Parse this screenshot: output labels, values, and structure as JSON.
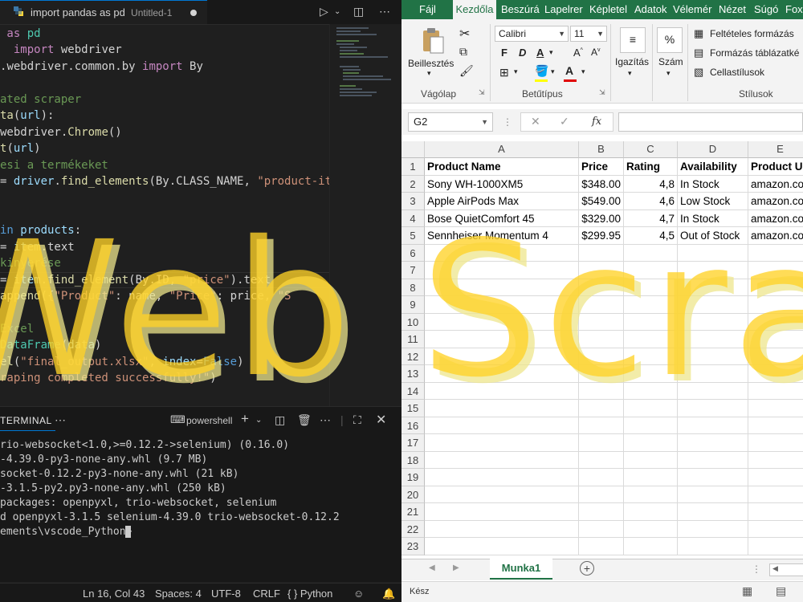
{
  "vscode": {
    "tab": {
      "title": "import pandas as pd",
      "subtitle": "Untitled-1"
    },
    "code_lines": [
      [
        [
          "kw",
          " as "
        ],
        [
          "cls",
          "pd"
        ]
      ],
      [
        [
          "wh",
          "  "
        ],
        [
          "kw",
          "import"
        ],
        [
          "wh",
          " webdriver"
        ]
      ],
      [
        [
          "wh",
          "."
        ],
        [
          "wh",
          "webdriver.common.by "
        ],
        [
          "kw",
          "import"
        ],
        [
          "wh",
          " By"
        ]
      ],
      [],
      [
        [
          "cmt",
          "ated scraper"
        ]
      ],
      [
        [
          "fn",
          "ta"
        ],
        [
          "wh",
          "("
        ],
        [
          "var",
          "url"
        ],
        [
          "wh",
          "):"
        ]
      ],
      [
        [
          "wh",
          "webdriver."
        ],
        [
          "fn",
          "Chrome"
        ],
        [
          "wh",
          "()"
        ]
      ],
      [
        [
          "fn",
          "t"
        ],
        [
          "wh",
          "("
        ],
        [
          "var",
          "url"
        ],
        [
          "wh",
          ")"
        ]
      ],
      [
        [
          "cmt",
          "esi a termékeket"
        ]
      ],
      [
        [
          "wh",
          "= "
        ],
        [
          "var",
          "driver"
        ],
        [
          "wh",
          "."
        ],
        [
          "fn",
          "find_elements"
        ],
        [
          "wh",
          "(By.CLASS_NAME, "
        ],
        [
          "str",
          "\"product-ite"
        ]
      ],
      [],
      [],
      [
        [
          "bi",
          "in"
        ],
        [
          "wh",
          " "
        ],
        [
          "var",
          "products"
        ],
        [
          "wh",
          ":"
        ]
      ],
      [
        [
          "wh",
          "= "
        ],
        [
          "var",
          "item"
        ],
        [
          "wh",
          ".text"
        ]
      ],
      [
        [
          "cmt",
          "kinyerése"
        ]
      ],
      [
        [
          "wh",
          "= "
        ],
        [
          "var",
          "item"
        ],
        [
          "wh",
          "."
        ],
        [
          "fn",
          "find_element"
        ],
        [
          "wh",
          "(By.ID, "
        ],
        [
          "str",
          "\"price\""
        ],
        [
          "wh",
          ").text"
        ]
      ],
      [
        [
          "fn",
          "append"
        ],
        [
          "wh",
          "({"
        ],
        [
          "str",
          "\"Product\""
        ],
        [
          "wh",
          ": name, "
        ],
        [
          "str",
          "\"Price\""
        ],
        [
          "wh",
          ": price, "
        ],
        [
          "str",
          "\"S"
        ]
      ],
      [],
      [
        [
          "cmt",
          "Excel"
        ]
      ],
      [
        [
          "cls",
          "DataFrame"
        ],
        [
          "wh",
          "("
        ],
        [
          "var",
          "data"
        ],
        [
          "wh",
          ")"
        ]
      ],
      [
        [
          "fn",
          "el"
        ],
        [
          "wh",
          "("
        ],
        [
          "str",
          "\"final_output.xlsx\""
        ],
        [
          "wh",
          ", "
        ],
        [
          "var",
          "index"
        ],
        [
          "wh",
          "="
        ],
        [
          "bi",
          "False"
        ],
        [
          "wh",
          ")"
        ]
      ],
      [
        [
          "str",
          "raping completed successfully!\""
        ],
        [
          "wh",
          ")"
        ]
      ]
    ],
    "panel": {
      "tab_label": "TERMINAL",
      "shell": "powershell",
      "lines": [
        "rio-websocket<1.0,>=0.12.2->selenium) (0.16.0)",
        "-4.39.0-py3-none-any.whl (9.7 MB)",
        "socket-0.12.2-py3-none-any.whl (21 kB)",
        "-3.1.5-py2.py3-none-any.whl (250 kB)",
        "packages: openpyxl, trio-websocket, selenium",
        "d openpyxl-3.1.5 selenium-4.39.0 trio-websocket-0.12.2",
        "ements\\vscode_Python> "
      ]
    },
    "status": {
      "position": "Ln 16, Col 43",
      "spaces": "Spaces: 4",
      "encoding": "UTF-8",
      "eol": "CRLF",
      "language": "{ } Python"
    }
  },
  "excel": {
    "tabs": [
      "Fájl",
      "Kezdőla",
      "Beszúrá",
      "Lapelrer",
      "Képletel",
      "Adatok",
      "Vélemér",
      "Nézet",
      "Súgó",
      "Fox"
    ],
    "ribbon": {
      "paste": "Beillesztés",
      "clipboard_group": "Vágólap",
      "font_name": "Calibri",
      "font_size": "11",
      "font_group": "Betűtípus",
      "alignment": "Igazítás",
      "number": "Szám",
      "conditional": "Feltételes formázás",
      "format_table": "Formázás táblázatké",
      "cell_styles": "Cellastílusok",
      "styles_group": "Stílusok"
    },
    "name_box": "G2",
    "fx": "fx",
    "columns": [
      "A",
      "B",
      "C",
      "D",
      "E"
    ],
    "rows": [
      [
        "Product Name",
        "Price",
        "Rating",
        "Availability",
        "Product U"
      ],
      [
        "Sony WH-1000XM5",
        "$348.00",
        "4,8",
        "In Stock",
        "amazon.co"
      ],
      [
        "Apple AirPods Max",
        "$549.00",
        "4,6",
        "Low Stock",
        "amazon.co"
      ],
      [
        "Bose QuietComfort 45",
        "$329.00",
        "4,7",
        "In Stock",
        "amazon.co"
      ],
      [
        "Sennheiser Momentum 4",
        "$299.95",
        "4,5",
        "Out of Stock",
        "amazon.co"
      ]
    ],
    "row_numbers": [
      "1",
      "2",
      "3",
      "4",
      "5",
      "6",
      "7",
      "8",
      "9",
      "10",
      "11",
      "12",
      "13",
      "14",
      "15",
      "16",
      "17",
      "18",
      "19",
      "20",
      "21",
      "22",
      "23"
    ],
    "sheet_tab": "Munka1",
    "status": "Kész"
  },
  "headline": "Web Scraping",
  "colors": {
    "excel_green": "#217346",
    "headline": "#ffd228",
    "vscode_bg": "#1f1f1f"
  }
}
